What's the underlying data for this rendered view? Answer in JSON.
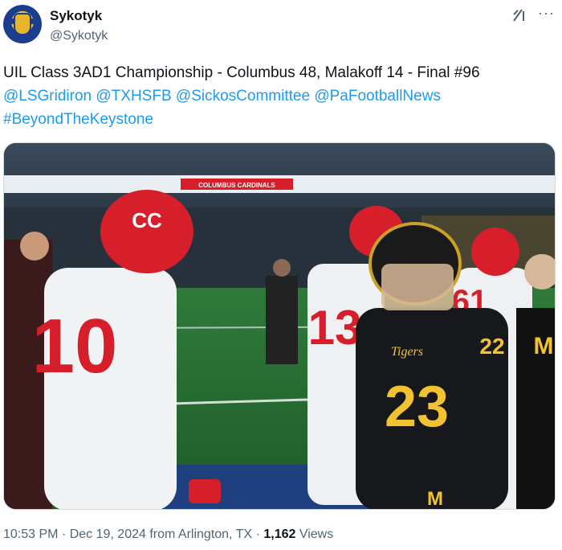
{
  "author": {
    "name": "Sykotyk",
    "handle": "@Sykotyk",
    "avatar_icon": "helmet-avatar-icon"
  },
  "header_actions": {
    "grok_icon": "grok-icon",
    "more_icon": "more-icon",
    "more_label": "···"
  },
  "tweet": {
    "line1": "UIL Class 3AD1 Championship - Columbus 48, Malakoff 14 - Final #96",
    "mentions": [
      "@LSGridiron",
      "@TXHSFB",
      "@SickosCommittee",
      "@PaFootballNews"
    ],
    "hashtag": "#BeyondTheKeystone"
  },
  "image": {
    "ribbon_text": "COLUMBUS CARDINALS",
    "jersey_left": "10",
    "jersey_mid": "13",
    "jersey_right": "61",
    "jersey_black": "23",
    "jersey_black_right": "22",
    "team_script": "Tigers",
    "logo_letter": "M",
    "helmet_letters": "CC"
  },
  "meta": {
    "time": "10:53 PM",
    "separator": "·",
    "date": "Dec 19, 2024 from Arlington, TX",
    "views_count": "1,162",
    "views_label": "Views"
  },
  "colors": {
    "link": "#1d9bf0",
    "text": "#0f1419",
    "secondary": "#536471",
    "cardinal_red": "#d71f2b",
    "tiger_gold": "#f2c230"
  }
}
